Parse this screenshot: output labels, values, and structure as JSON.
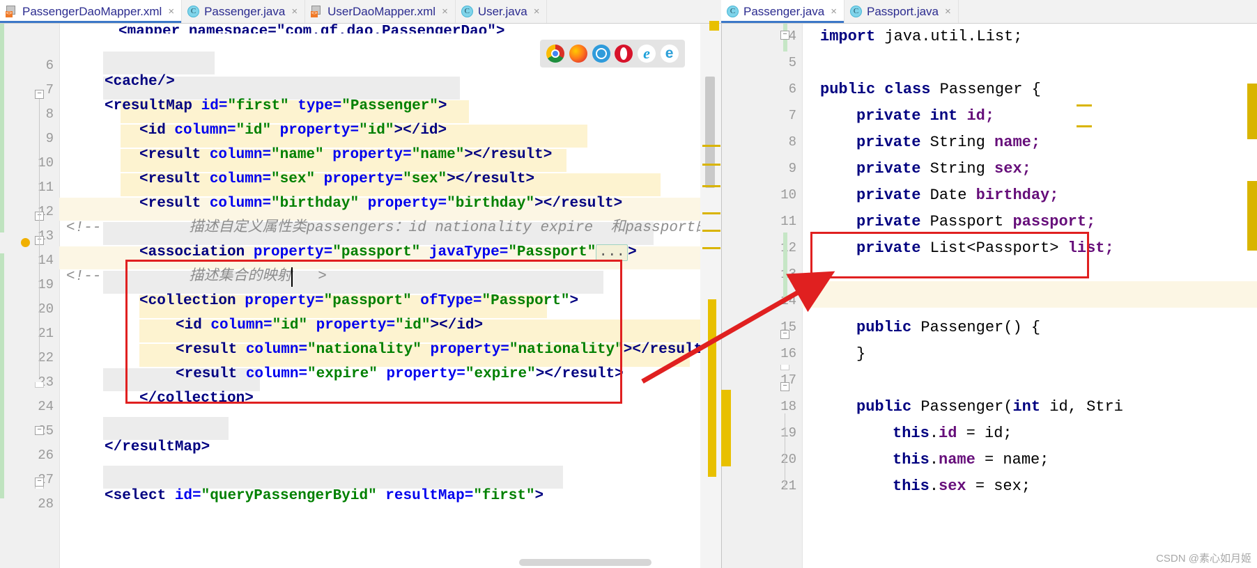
{
  "window": {
    "left_tabs": [
      {
        "label": "PassengerDaoMapper.xml",
        "icon": "xml-file-icon",
        "selected": true,
        "close": "×"
      },
      {
        "label": "Passenger.java",
        "icon": "java-class-icon",
        "selected": false,
        "close": "×"
      },
      {
        "label": "UserDaoMapper.xml",
        "icon": "xml-file-icon",
        "selected": false,
        "close": "×"
      },
      {
        "label": "User.java",
        "icon": "java-class-icon",
        "selected": false,
        "close": "×"
      }
    ],
    "right_tabs": [
      {
        "label": "Passenger.java",
        "icon": "java-class-icon",
        "selected": true,
        "close": "×"
      },
      {
        "label": "Passport.java",
        "icon": "java-class-icon",
        "selected": false,
        "close": "×"
      }
    ]
  },
  "browser_bar": {
    "icons": [
      "chrome-icon",
      "firefox-icon",
      "safari-icon",
      "opera-icon",
      "internet-explorer-icon",
      "edge-icon"
    ],
    "ie_glyph": "e",
    "edge_glyph": "e"
  },
  "left_editor": {
    "file": "PassengerDaoMapper.xml",
    "partial_top_line": "<mapper namespace=\"com.qf.dao.PassengerDao\">",
    "line_numbers": [
      "6",
      "7",
      "8",
      "9",
      "10",
      "11",
      "12",
      "13",
      "14",
      "19",
      "20",
      "21",
      "22",
      "23",
      "24",
      "25",
      "26",
      "27",
      "28"
    ],
    "lines": [
      {
        "num": "6",
        "text": ""
      },
      {
        "num": "7",
        "text": "    <cache/>"
      },
      {
        "num": "8",
        "text": "    <resultMap id=\"first\" type=\"Passenger\">"
      },
      {
        "num": "9",
        "text": "        <id column=\"id\" property=\"id\"></id>"
      },
      {
        "num": "10",
        "text": "        <result column=\"name\" property=\"name\"></result>"
      },
      {
        "num": "11",
        "text": "        <result column=\"sex\" property=\"sex\"></result>"
      },
      {
        "num": "12",
        "text": "        <result column=\"birthday\" property=\"birthday\"></result>"
      },
      {
        "num": "13",
        "text": "    <!--        描述自定义属性类passengers：id nationality expire  和passport的"
      },
      {
        "num": "14",
        "text": "        <association property=\"passport\" javaType=\"Passport\"...>"
      },
      {
        "num": "19",
        "text": "    <!--        描述集合的映射  >"
      },
      {
        "num": "20",
        "text": "        <collection property=\"passport\" ofType=\"Passport\">"
      },
      {
        "num": "21",
        "text": "            <id column=\"id\" property=\"id\"></id>"
      },
      {
        "num": "22",
        "text": "            <result column=\"nationality\" property=\"nationality\"></result>"
      },
      {
        "num": "23",
        "text": "            <result column=\"expire\" property=\"expire\"></result>"
      },
      {
        "num": "24",
        "text": "        </collection>"
      },
      {
        "num": "25",
        "text": ""
      },
      {
        "num": "26",
        "text": "    </resultMap>"
      },
      {
        "num": "27",
        "text": ""
      },
      {
        "num": "28",
        "text": "    <select id=\"queryPassengerByid\" resultMap=\"first\">"
      }
    ],
    "tokens": {
      "cache_tag": "<cache/>",
      "resultmap_open_tag": "<resultMap ",
      "attr_id": "id=",
      "val_first": "\"first\"",
      "attr_type": "type=",
      "val_passenger": "\"Passenger\"",
      "gt": ">",
      "id_open": "<id ",
      "attr_column": "column=",
      "val_id": "\"id\"",
      "attr_property": "property=",
      "id_close": "</id>",
      "result_open": "<result ",
      "result_close": "</result>",
      "val_name": "\"name\"",
      "val_sex": "\"sex\"",
      "val_birthday": "\"birthday\"",
      "val_nationality": "\"nationality\"",
      "val_expire": "\"expire\"",
      "comment_open": "<!--",
      "comment_13": "描述自定义属性类passengers：id nationality expire  和passport的",
      "comment_19": "描述集合的映射",
      "comment_19_end": ">",
      "association_open": "<association ",
      "attr_javatype": "javaType=",
      "val_passport": "\"Passport\"",
      "val_passport_prop": "\"passport\"",
      "fold_ellipsis": "...",
      "collection_open": "<collection ",
      "attr_oftype": "ofType=",
      "collection_close": "</collection>",
      "resultmap_close": "</resultMap>",
      "select_open": "<select ",
      "val_querybyid": "\"queryPassengerByid\"",
      "attr_resultmap": "resultMap="
    }
  },
  "right_editor": {
    "file": "Passenger.java",
    "lines": [
      {
        "num": "4",
        "text": "import java.util.List;"
      },
      {
        "num": "5",
        "text": ""
      },
      {
        "num": "6",
        "text": "public class Passenger {"
      },
      {
        "num": "7",
        "text": "    private int id;"
      },
      {
        "num": "8",
        "text": "    private String name;"
      },
      {
        "num": "9",
        "text": "    private String sex;"
      },
      {
        "num": "10",
        "text": "    private Date birthday;"
      },
      {
        "num": "11",
        "text": "    private Passport passport;"
      },
      {
        "num": "12",
        "text": "    private List<Passport> list;"
      },
      {
        "num": "13",
        "text": ""
      },
      {
        "num": "14",
        "text": ""
      },
      {
        "num": "15",
        "text": "    public Passenger() {"
      },
      {
        "num": "16",
        "text": "    }"
      },
      {
        "num": "17",
        "text": ""
      },
      {
        "num": "18",
        "text": "    public Passenger(int id, Stri"
      },
      {
        "num": "19",
        "text": "        this.id = id;"
      },
      {
        "num": "20",
        "text": "        this.name = name;"
      },
      {
        "num": "21",
        "text": "        this.sex = sex;"
      }
    ],
    "tokens": {
      "kw_import": "import",
      "import_pkg": " java.util.List;",
      "kw_public": "public",
      "kw_class": "class",
      "cls_passenger": "Passenger",
      "brace_open": "{",
      "brace_close": "}",
      "kw_private": "private",
      "t_int": "int",
      "t_string": "String",
      "t_date": "Date",
      "t_passport": "Passport",
      "t_list": "List<Passport>",
      "f_id": "id;",
      "f_name": "name;",
      "f_sex": "sex;",
      "f_birthday": "birthday;",
      "f_passport": "passport;",
      "f_list": "list;",
      "ctor_empty": "public Passenger() {",
      "ctor_args": "public Passenger(int id, Stri",
      "asg_id": "this.id = id;",
      "asg_name": "this.name = name;",
      "asg_sex": "this.sex = sex;",
      "kw_this": "this",
      "dot": ".",
      "eq": " = "
    }
  },
  "annotations": {
    "left_highlight_box_color": "#e02020",
    "right_highlight_box_color": "#e02020",
    "arrow_color": "#e02020",
    "arrow_description": "red-arrow-from-xml-collection-to-java-list-field"
  },
  "watermark": "CSDN @素心如月姬"
}
